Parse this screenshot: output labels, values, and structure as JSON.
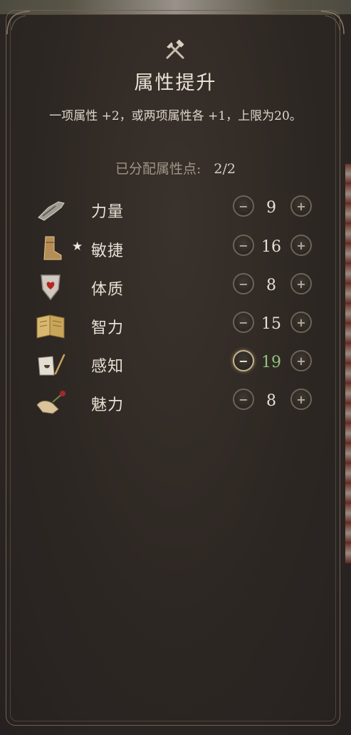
{
  "header": {
    "title": "属性提升",
    "subtitle": "一项属性 +2，或两项属性各 +1，上限为20。",
    "points_label": "已分配属性点:",
    "points_value": "2/2"
  },
  "controls": {
    "minus_glyph": "−",
    "plus_glyph": "+"
  },
  "attributes": [
    {
      "name": "力量",
      "value": "9",
      "icon": "gauntlet-icon",
      "starred": false,
      "changed": false
    },
    {
      "name": "敏捷",
      "value": "16",
      "icon": "boot-icon",
      "starred": true,
      "star_glyph": "★",
      "changed": false
    },
    {
      "name": "体质",
      "value": "8",
      "icon": "shield-heart-icon",
      "starred": false,
      "changed": false
    },
    {
      "name": "智力",
      "value": "15",
      "icon": "book-icon",
      "starred": false,
      "changed": false
    },
    {
      "name": "感知",
      "value": "19",
      "icon": "hand-quill-icon",
      "starred": false,
      "changed": true
    },
    {
      "name": "魅力",
      "value": "8",
      "icon": "hand-rose-icon",
      "starred": false,
      "changed": false
    }
  ],
  "colors": {
    "changed_value": "#8fc47a",
    "text": "#e6dfd3",
    "frame": "#6e6151"
  }
}
